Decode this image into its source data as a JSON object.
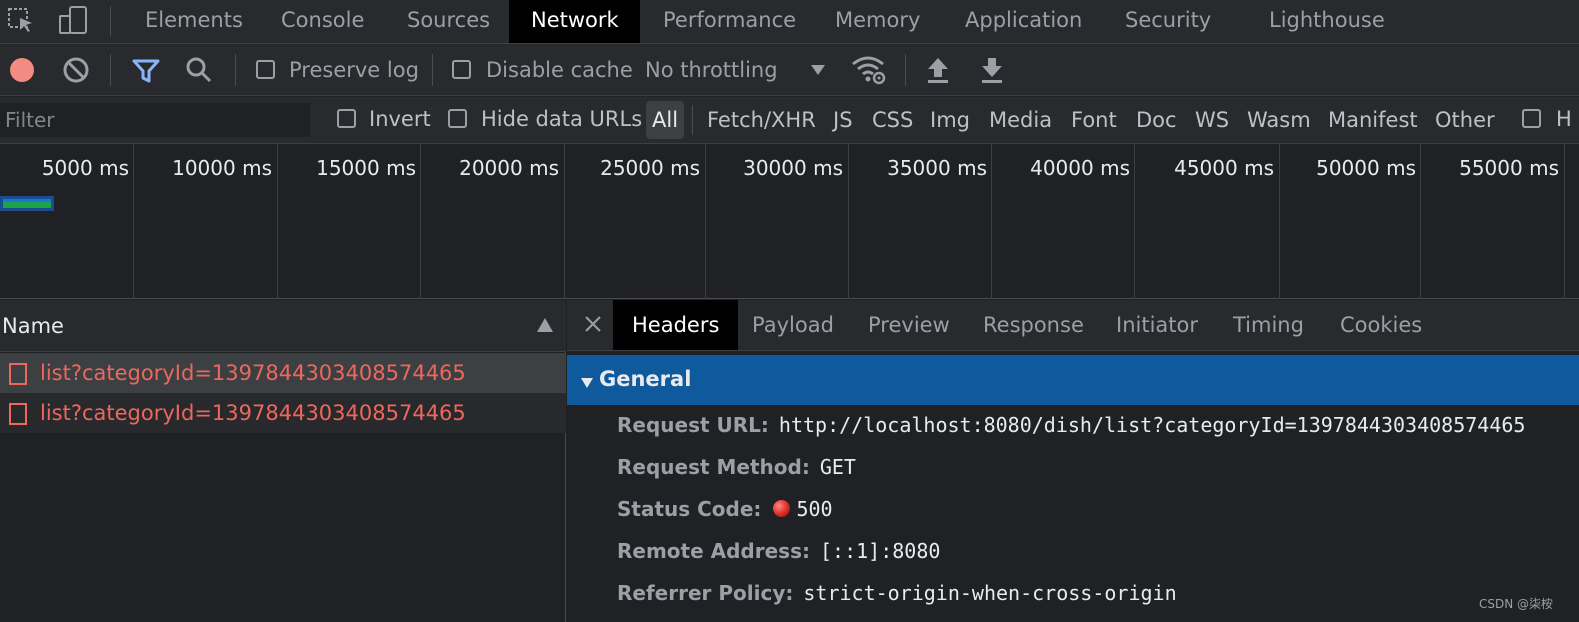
{
  "main_tabs": [
    {
      "label": "Elements"
    },
    {
      "label": "Console"
    },
    {
      "label": "Sources"
    },
    {
      "label": "Network"
    },
    {
      "label": "Performance"
    },
    {
      "label": "Memory"
    },
    {
      "label": "Application"
    },
    {
      "label": "Security"
    },
    {
      "label": "Lighthouse"
    }
  ],
  "active_tab": "Network",
  "toolbar": {
    "preserve_log": "Preserve log",
    "disable_cache": "Disable cache",
    "throttling": "No throttling"
  },
  "filter": {
    "placeholder": "Filter",
    "invert": "Invert",
    "hide_data_urls": "Hide data URLs",
    "types": [
      "All",
      "Fetch/XHR",
      "JS",
      "CSS",
      "Img",
      "Media",
      "Font",
      "Doc",
      "WS",
      "Wasm",
      "Manifest",
      "Other"
    ],
    "trailing": "H"
  },
  "overview": {
    "ticks": [
      "5000 ms",
      "10000 ms",
      "15000 ms",
      "20000 ms",
      "25000 ms",
      "30000 ms",
      "35000 ms",
      "40000 ms",
      "45000 ms",
      "50000 ms",
      "55000 ms"
    ]
  },
  "request_list": {
    "column_name": "Name",
    "rows": [
      {
        "name": "list?categoryId=1397844303408574465"
      },
      {
        "name": "list?categoryId=1397844303408574465"
      }
    ]
  },
  "details": {
    "tabs": [
      "Headers",
      "Payload",
      "Preview",
      "Response",
      "Initiator",
      "Timing",
      "Cookies"
    ],
    "active_tab": "Headers",
    "section_title": "General",
    "headers": [
      {
        "key": "Request URL:",
        "value": "http://localhost:8080/dish/list?categoryId=1397844303408574465"
      },
      {
        "key": "Request Method:",
        "value": "GET"
      },
      {
        "key": "Status Code:",
        "value": "500"
      },
      {
        "key": "Remote Address:",
        "value": "[::1]:8080"
      },
      {
        "key": "Referrer Policy:",
        "value": "strict-origin-when-cross-origin"
      }
    ]
  },
  "watermark": "CSDN @柒桉",
  "colors": {
    "record": "#f28b82",
    "error_text": "#ee675c",
    "section_bg": "#0e5a9c",
    "filter_icon": "#8ab4f8"
  }
}
